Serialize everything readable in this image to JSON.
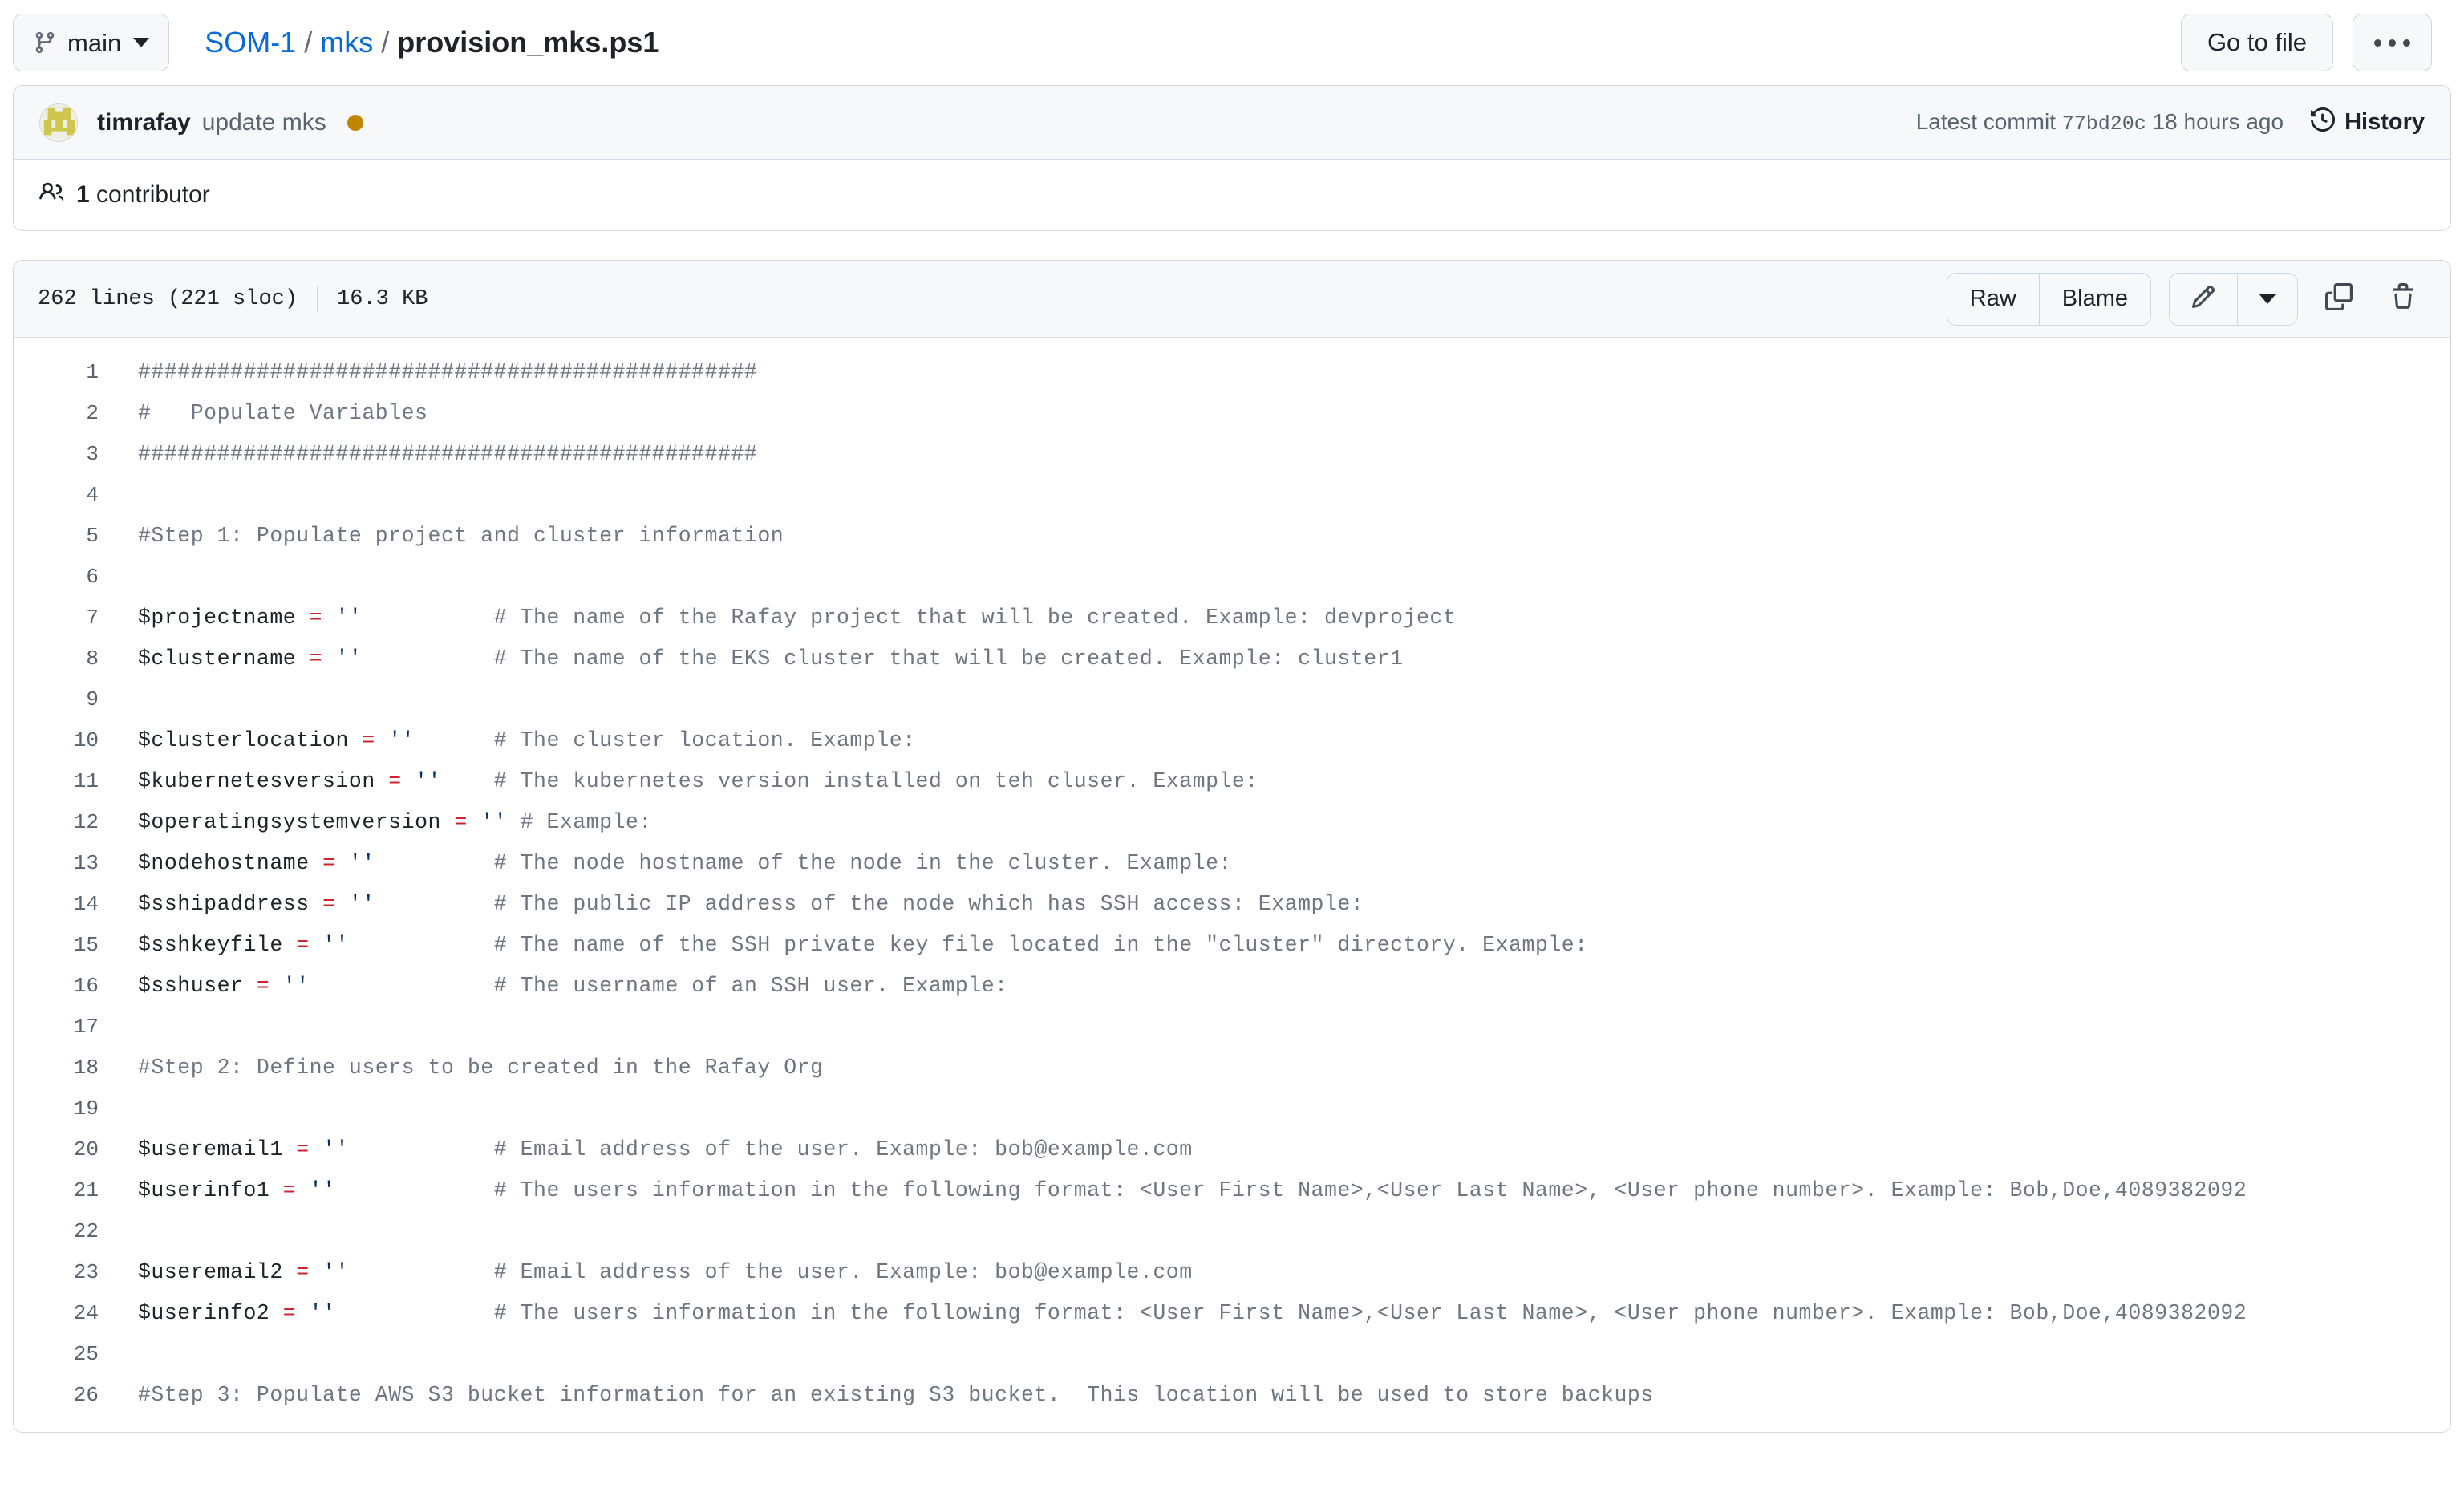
{
  "header": {
    "branch": {
      "label": "main",
      "icon": "branch-icon"
    },
    "breadcrumb": {
      "repo": "SOM-1",
      "folder": "mks",
      "file": "provision_mks.ps1",
      "separator": "/"
    },
    "go_to_file_label": "Go to file",
    "kebab_label": "…"
  },
  "commit": {
    "author": "timrafay",
    "message": "update mks",
    "latest_commit_prefix": "Latest commit",
    "sha": "77bd20c",
    "relative_time": "18 hours ago",
    "history_label": "History",
    "status_color": "#bf8700"
  },
  "contributors": {
    "count_label": "1",
    "label": "contributor",
    "full": "1 contributor"
  },
  "file_toolbar": {
    "lines": "262 lines (221 sloc)",
    "size": "16.3 KB",
    "raw_label": "Raw",
    "blame_label": "Blame",
    "edit_icon": "pencil-icon",
    "more_edit_icon": "chevron-down-icon",
    "copy_icon": "copy-icon",
    "delete_icon": "trash-icon"
  },
  "code": {
    "language": "powershell",
    "lines": [
      {
        "n": 1,
        "tokens": [
          {
            "t": "comment",
            "v": "###############################################"
          }
        ]
      },
      {
        "n": 2,
        "tokens": [
          {
            "t": "comment",
            "v": "#   Populate Variables"
          }
        ]
      },
      {
        "n": 3,
        "tokens": [
          {
            "t": "comment",
            "v": "###############################################"
          }
        ]
      },
      {
        "n": 4,
        "tokens": []
      },
      {
        "n": 5,
        "tokens": [
          {
            "t": "comment",
            "v": "#Step 1: Populate project and cluster information"
          }
        ]
      },
      {
        "n": 6,
        "tokens": []
      },
      {
        "n": 7,
        "tokens": [
          {
            "t": "var",
            "v": "$projectname "
          },
          {
            "t": "op",
            "v": "="
          },
          {
            "t": "str",
            "v": " ''"
          },
          {
            "t": "plain",
            "v": "          "
          },
          {
            "t": "comment",
            "v": "# The name of the Rafay project that will be created. Example: devproject"
          }
        ]
      },
      {
        "n": 8,
        "tokens": [
          {
            "t": "var",
            "v": "$clustername "
          },
          {
            "t": "op",
            "v": "="
          },
          {
            "t": "str",
            "v": " ''"
          },
          {
            "t": "plain",
            "v": "          "
          },
          {
            "t": "comment",
            "v": "# The name of the EKS cluster that will be created. Example: cluster1"
          }
        ]
      },
      {
        "n": 9,
        "tokens": []
      },
      {
        "n": 10,
        "tokens": [
          {
            "t": "var",
            "v": "$clusterlocation "
          },
          {
            "t": "op",
            "v": "="
          },
          {
            "t": "str",
            "v": " ''"
          },
          {
            "t": "plain",
            "v": "      "
          },
          {
            "t": "comment",
            "v": "# The cluster location. Example:"
          }
        ]
      },
      {
        "n": 11,
        "tokens": [
          {
            "t": "var",
            "v": "$kubernetesversion "
          },
          {
            "t": "op",
            "v": "="
          },
          {
            "t": "str",
            "v": " ''"
          },
          {
            "t": "plain",
            "v": "    "
          },
          {
            "t": "comment",
            "v": "# The kubernetes version installed on teh cluser. Example:"
          }
        ]
      },
      {
        "n": 12,
        "tokens": [
          {
            "t": "var",
            "v": "$operatingsystemversion "
          },
          {
            "t": "op",
            "v": "="
          },
          {
            "t": "str",
            "v": " ''"
          },
          {
            "t": "plain",
            "v": " "
          },
          {
            "t": "comment",
            "v": "# Example:"
          }
        ]
      },
      {
        "n": 13,
        "tokens": [
          {
            "t": "var",
            "v": "$nodehostname "
          },
          {
            "t": "op",
            "v": "="
          },
          {
            "t": "str",
            "v": " ''"
          },
          {
            "t": "plain",
            "v": "         "
          },
          {
            "t": "comment",
            "v": "# The node hostname of the node in the cluster. Example:"
          }
        ]
      },
      {
        "n": 14,
        "tokens": [
          {
            "t": "var",
            "v": "$sshipaddress "
          },
          {
            "t": "op",
            "v": "="
          },
          {
            "t": "str",
            "v": " ''"
          },
          {
            "t": "plain",
            "v": "         "
          },
          {
            "t": "comment",
            "v": "# The public IP address of the node which has SSH access: Example:"
          }
        ]
      },
      {
        "n": 15,
        "tokens": [
          {
            "t": "var",
            "v": "$sshkeyfile "
          },
          {
            "t": "op",
            "v": "="
          },
          {
            "t": "str",
            "v": " ''"
          },
          {
            "t": "plain",
            "v": "           "
          },
          {
            "t": "comment",
            "v": "# The name of the SSH private key file located in the \"cluster\" directory. Example:"
          }
        ]
      },
      {
        "n": 16,
        "tokens": [
          {
            "t": "var",
            "v": "$sshuser "
          },
          {
            "t": "op",
            "v": "="
          },
          {
            "t": "str",
            "v": " ''"
          },
          {
            "t": "plain",
            "v": "              "
          },
          {
            "t": "comment",
            "v": "# The username of an SSH user. Example:"
          }
        ]
      },
      {
        "n": 17,
        "tokens": []
      },
      {
        "n": 18,
        "tokens": [
          {
            "t": "comment",
            "v": "#Step 2: Define users to be created in the Rafay Org"
          }
        ]
      },
      {
        "n": 19,
        "tokens": []
      },
      {
        "n": 20,
        "tokens": [
          {
            "t": "var",
            "v": "$useremail1 "
          },
          {
            "t": "op",
            "v": "="
          },
          {
            "t": "str",
            "v": " ''"
          },
          {
            "t": "plain",
            "v": "           "
          },
          {
            "t": "comment",
            "v": "# Email address of the user. Example: bob@example.com"
          }
        ]
      },
      {
        "n": 21,
        "tokens": [
          {
            "t": "var",
            "v": "$userinfo1 "
          },
          {
            "t": "op",
            "v": "="
          },
          {
            "t": "str",
            "v": " ''"
          },
          {
            "t": "plain",
            "v": "            "
          },
          {
            "t": "comment",
            "v": "# The users information in the following format: <User First Name>,<User Last Name>, <User phone number>. Example: Bob,Doe,4089382092"
          }
        ]
      },
      {
        "n": 22,
        "tokens": []
      },
      {
        "n": 23,
        "tokens": [
          {
            "t": "var",
            "v": "$useremail2 "
          },
          {
            "t": "op",
            "v": "="
          },
          {
            "t": "str",
            "v": " ''"
          },
          {
            "t": "plain",
            "v": "           "
          },
          {
            "t": "comment",
            "v": "# Email address of the user. Example: bob@example.com"
          }
        ]
      },
      {
        "n": 24,
        "tokens": [
          {
            "t": "var",
            "v": "$userinfo2 "
          },
          {
            "t": "op",
            "v": "="
          },
          {
            "t": "str",
            "v": " ''"
          },
          {
            "t": "plain",
            "v": "            "
          },
          {
            "t": "comment",
            "v": "# The users information in the following format: <User First Name>,<User Last Name>, <User phone number>. Example: Bob,Doe,4089382092"
          }
        ]
      },
      {
        "n": 25,
        "tokens": []
      },
      {
        "n": 26,
        "tokens": [
          {
            "t": "comment",
            "v": "#Step 3: Populate AWS S3 bucket information for an existing S3 bucket.  This location will be used to store backups"
          }
        ]
      }
    ]
  },
  "colors": {
    "link": "#0969da",
    "text": "#1f2328",
    "muted": "#59636e",
    "comment": "#6e7781",
    "operator": "#cf222e",
    "string": "#0a3069",
    "border": "#d0d7de",
    "surface": "#f6f8fa"
  }
}
